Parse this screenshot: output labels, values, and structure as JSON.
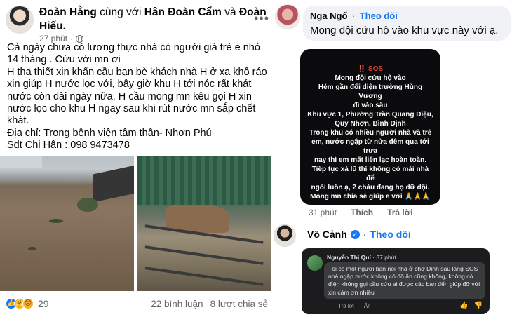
{
  "post": {
    "author": "Đoàn Hằng",
    "with_text": "cùng với",
    "tagged_1": "Hân Đoàn Cẩm",
    "and_text": "và",
    "tagged_2": "Đoàn Hiếu.",
    "time": "27 phút",
    "more_icon": "more-icon",
    "lines": [
      "Cả ngày chưa có lương thực nhà có người già trẻ e nhỏ 14 tháng . Cứu với mn ơi",
      "H tha thiết xin khẩn cầu bạn bè khách nhà H ở xa khô ráo xin giúp H nước lọc với, bây giờ khu H tới nóc rất khát nước còn dài ngày nữa, H cầu mong mn kêu gọi H xin nước lọc cho khu H ngay sau khi rút nước mn sắp chết khát.",
      "Địa chỉ: Trong bệnh viện tâm thần- Nhơn Phú",
      "Sdt Chị Hân : 098 9473478"
    ],
    "reaction_icons": [
      "like-icon",
      "care-icon",
      "sad-icon"
    ],
    "reaction_count": "29",
    "comments": "22 bình luận",
    "shares": "8 lượt chia sẻ"
  },
  "comment1": {
    "name": "Nga Ngố",
    "follow": "Theo dõi",
    "text": "Mong đội cứu hộ vào khu vực này với ạ.",
    "image_lines": [
      "‼️ SOS",
      "Mong đội cứu hộ vào",
      "Hẻm gần đối diện trường Hùng Vương",
      "đi vào sâu",
      "Khu vực 1, Phường Trần Quang Diệu,",
      "Quy Nhơn, Bình Định",
      "Trong khu có nhiều người nhà và trẻ",
      "em, nước ngập từ nửa đêm qua tới trưa",
      "nay thì em mất liên lạc hoàn toàn.",
      "Tiếp tục xả lũ thì không có mái nhà để",
      "ngồi luôn ạ, 2 cháu đang họ dữ dội.",
      "Mong mn chia sẻ giúp e với 🙏🙏🙏"
    ],
    "time": "31 phút",
    "like": "Thích",
    "reply": "Trả lời"
  },
  "comment2": {
    "name": "Võ Cảnh",
    "follow": "Theo dõi",
    "inner": {
      "name": "Nguyễn Thị Quí",
      "time": "37 phút",
      "text": "Tôi có một người bạn nói nhà ở chợ Dinh sau làng SOS nhà ngập nước không có đồ ăn cũng không, không có điện không gọi cầu cứu ai được các bạn đến giúp đỡ với xin cảm ơn nhiều",
      "reply": "Trả lời",
      "hide": "Ẩn"
    }
  }
}
